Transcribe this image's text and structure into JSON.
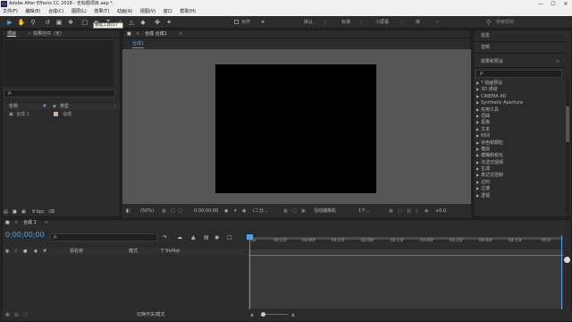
{
  "titlebar": {
    "app_icon": "Ae",
    "title": "Adobe After Effects CC 2018 - 无标题项目.aep *",
    "minimize_glyph": "—",
    "maximize_glyph": "☐",
    "close_glyph": "✕"
  },
  "menu": {
    "items": [
      "文件(F)",
      "编辑(E)",
      "合成(C)",
      "图层(L)",
      "效果(T)",
      "动画(A)",
      "视图(V)",
      "窗口",
      "帮助(H)"
    ]
  },
  "toolbar": {
    "snap_label": "对齐",
    "tooltip": "钢笔工具(G)",
    "workspaces": [
      "默认",
      "标准",
      "小屏幕",
      "库"
    ],
    "search_placeholder": "搜索帮助"
  },
  "project_panel": {
    "tabs": [
      "项目",
      "效果控件（无）"
    ],
    "search_placeholder": "ρ.",
    "columns": [
      "名称",
      "类型"
    ],
    "items": [
      {
        "name": "合成 1",
        "type": "合成"
      }
    ],
    "bpc": "8 bpc"
  },
  "comp_panel": {
    "tab_label": "合成 合成1",
    "breadcrumb": "合成1",
    "zoom": "(50%)",
    "timecode": "0;00;00;00",
    "resolution": "(二分...",
    "camera": "活动摄像机",
    "views": "1个...",
    "exposure": "+0.0"
  },
  "right_panel": {
    "tabs": [
      "信息",
      "音频",
      "效果和预设"
    ],
    "search_placeholder": "ρ.",
    "effects": [
      "* 动画预设",
      "3D 通道",
      "CINEMA 4D",
      "Synthetic Aperture",
      "实用工具",
      "扭曲",
      "抠像",
      "文本",
      "时间",
      "杂色和颗粒",
      "模拟",
      "模糊和锐化",
      "沉浸式视频",
      "生成",
      "表达式控制",
      "过时",
      "过渡",
      "透视"
    ]
  },
  "timeline": {
    "tab_label": "合成 1",
    "timecode": "0;00;00;00",
    "search_placeholder": "ρ.",
    "layer_columns": [
      "源名称",
      "模式",
      "T TrkMat"
    ],
    "ruler_ticks": [
      "0s",
      "00:15f",
      "01:00f",
      "01:15f",
      "02:00f",
      "02:15f",
      "03:00f",
      "03:15f",
      "04:00f",
      "04:15f",
      "05:0"
    ],
    "toggle_label": "切换开关/模式"
  },
  "colors": {
    "accent_blue": "#4ea0e8",
    "track_green": "#2e9e3c",
    "canvas": "#000000",
    "viewer_bg": "#555555"
  }
}
